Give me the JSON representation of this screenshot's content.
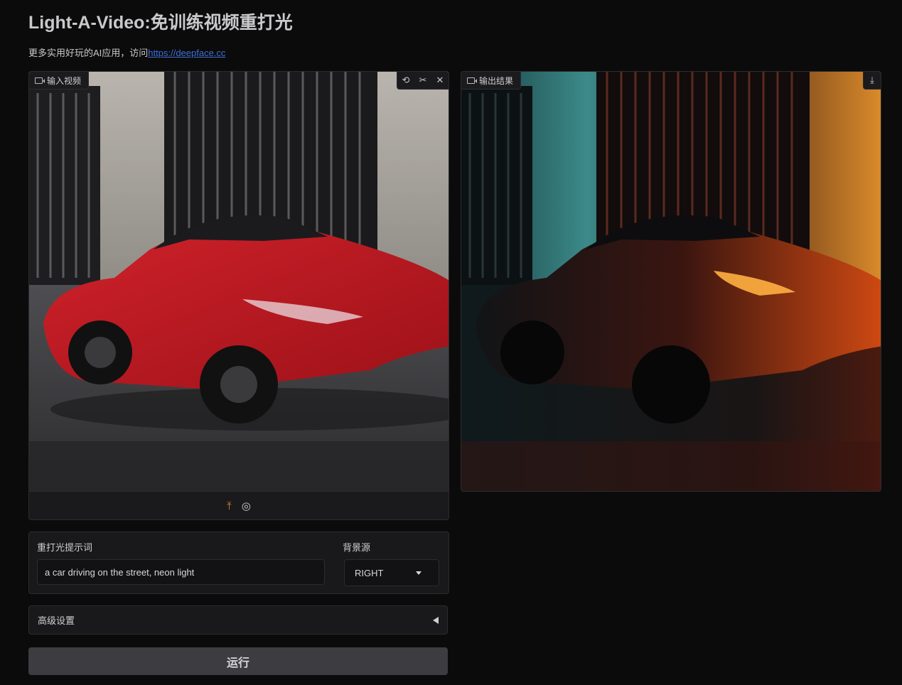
{
  "header": {
    "title": "Light-A-Video:免训练视频重打光",
    "subtitle_prefix": "更多实用好玩的AI应用，访问",
    "subtitle_link": "https://deepface.cc"
  },
  "input_video": {
    "label": "输入视频",
    "tools": [
      "undo-icon",
      "scissors-icon",
      "close-icon"
    ],
    "bottom_icons": [
      "upload-icon",
      "webcam-icon"
    ]
  },
  "output_video": {
    "label": "输出结果",
    "tools": [
      "download-icon"
    ]
  },
  "form": {
    "prompt_label": "重打光提示词",
    "prompt_value": "a car driving on the street, neon light",
    "bg_label": "背景源",
    "bg_value": "RIGHT"
  },
  "advanced": {
    "label": "高级设置"
  },
  "run_button": {
    "label": "运行"
  },
  "colors": {
    "background": "#0b0b0c",
    "panel": "#19191b",
    "border": "#2c2c30",
    "link": "#3f6fd6",
    "upload_accent": "#e8862a",
    "button": "#3d3d41"
  }
}
